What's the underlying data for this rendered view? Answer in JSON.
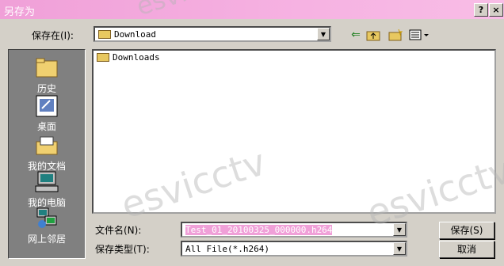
{
  "window": {
    "title": "另存为",
    "help_btn": "?",
    "close_btn": "×"
  },
  "save_in": {
    "label": "保存在(I):",
    "value": "Download"
  },
  "toolbar": {
    "back_icon": "back-arrow-icon",
    "up_icon": "up-folder-icon",
    "new_folder_icon": "new-folder-icon",
    "view_icon": "view-menu-icon"
  },
  "sidebar": {
    "items": [
      {
        "label": "历史",
        "icon": "history-folder-icon"
      },
      {
        "label": "桌面",
        "icon": "desktop-icon"
      },
      {
        "label": "我的文档",
        "icon": "my-documents-icon"
      },
      {
        "label": "我的电脑",
        "icon": "my-computer-icon"
      },
      {
        "label": "网上邻居",
        "icon": "network-icon"
      }
    ]
  },
  "files": [
    {
      "name": "Downloads"
    }
  ],
  "filename": {
    "label": "文件名(N):",
    "value": "Test_01_20100325_000000.h264"
  },
  "filetype": {
    "label": "保存类型(T):",
    "value": "All File(*.h264)"
  },
  "buttons": {
    "save": "保存(S)",
    "cancel": "取消"
  },
  "watermark": "esvicctv"
}
